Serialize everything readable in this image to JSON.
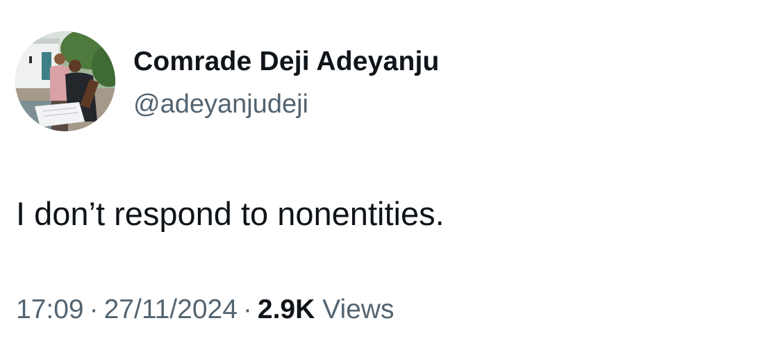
{
  "tweet": {
    "author": {
      "display_name": "Comrade Deji Adeyanju",
      "handle": "@adeyanjudeji",
      "avatar_icon": "profile-photo"
    },
    "text": "I don’t respond to nonentities.",
    "time": "17:09",
    "separator": "·",
    "date": "27/11/2024",
    "views_count": "2.9K",
    "views_label": "Views"
  },
  "colors": {
    "text_primary": "#0f1419",
    "text_secondary": "#536471",
    "background": "#ffffff"
  }
}
